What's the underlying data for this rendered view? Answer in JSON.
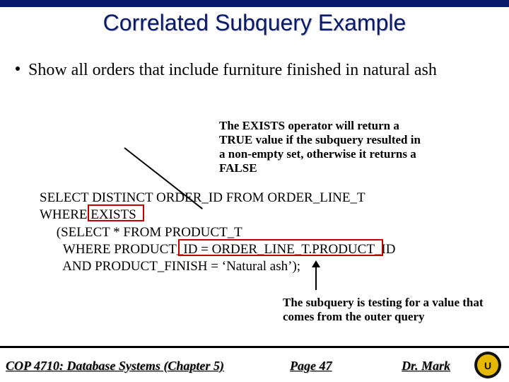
{
  "title": "Correlated Subquery Example",
  "bullet": "Show all orders that include furniture finished in natural ash",
  "note_exists": "The EXISTS operator will return a TRUE value if the subquery resulted in a non-empty set, otherwise it returns a FALSE",
  "sql": {
    "l1": "SELECT DISTINCT ORDER_ID FROM ORDER_LINE_T",
    "l2": "WHERE EXISTS",
    "l3": "     (SELECT * FROM PRODUCT_T",
    "l4": "       WHERE PRODUCT_ID = ORDER_LINE_T.PRODUCT_ID",
    "l5": "       AND PRODUCT_FINISH = ‘Natural ash’);"
  },
  "note_correlated": "The subquery is testing for a value that comes from the outer query",
  "footer": {
    "left": "COP 4710: Database Systems (Chapter 5)",
    "center": "Page 47",
    "right": "Dr. Mark"
  }
}
